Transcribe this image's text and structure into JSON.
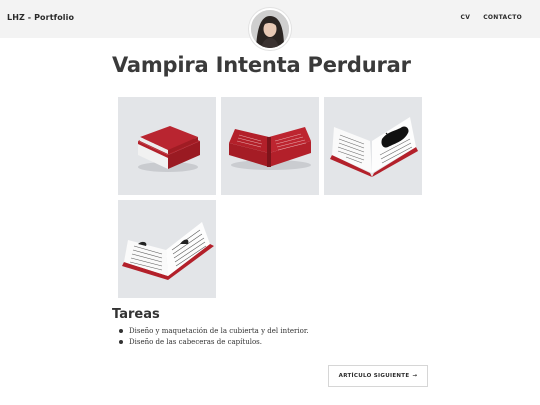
{
  "header": {
    "brand": "LHZ - Portfolio",
    "nav": [
      {
        "label": "CV"
      },
      {
        "label": "CONTACTO"
      }
    ]
  },
  "page": {
    "title": "Vampira Intenta Perdurar"
  },
  "gallery": {
    "images": [
      {
        "icon": "closed-book-stack-image",
        "cover_color": "#b3202a"
      },
      {
        "icon": "open-book-cover-image",
        "cover_color": "#b3202a"
      },
      {
        "icon": "open-book-spread-image",
        "cover_color": "#b3202a"
      },
      {
        "icon": "open-book-interior-image",
        "cover_color": "#b3202a"
      }
    ]
  },
  "tasks": {
    "title": "Tareas",
    "items": [
      "Diseño y maquetación de la cubierta y del interior.",
      "Diseño de las cabeceras de capítulos."
    ]
  },
  "next": {
    "label": "ARTÍCULO SIGUIENTE",
    "arrow": "→"
  },
  "colors": {
    "header_bg": "#f3f3f3",
    "book_red": "#b3202a",
    "text": "#333333"
  }
}
